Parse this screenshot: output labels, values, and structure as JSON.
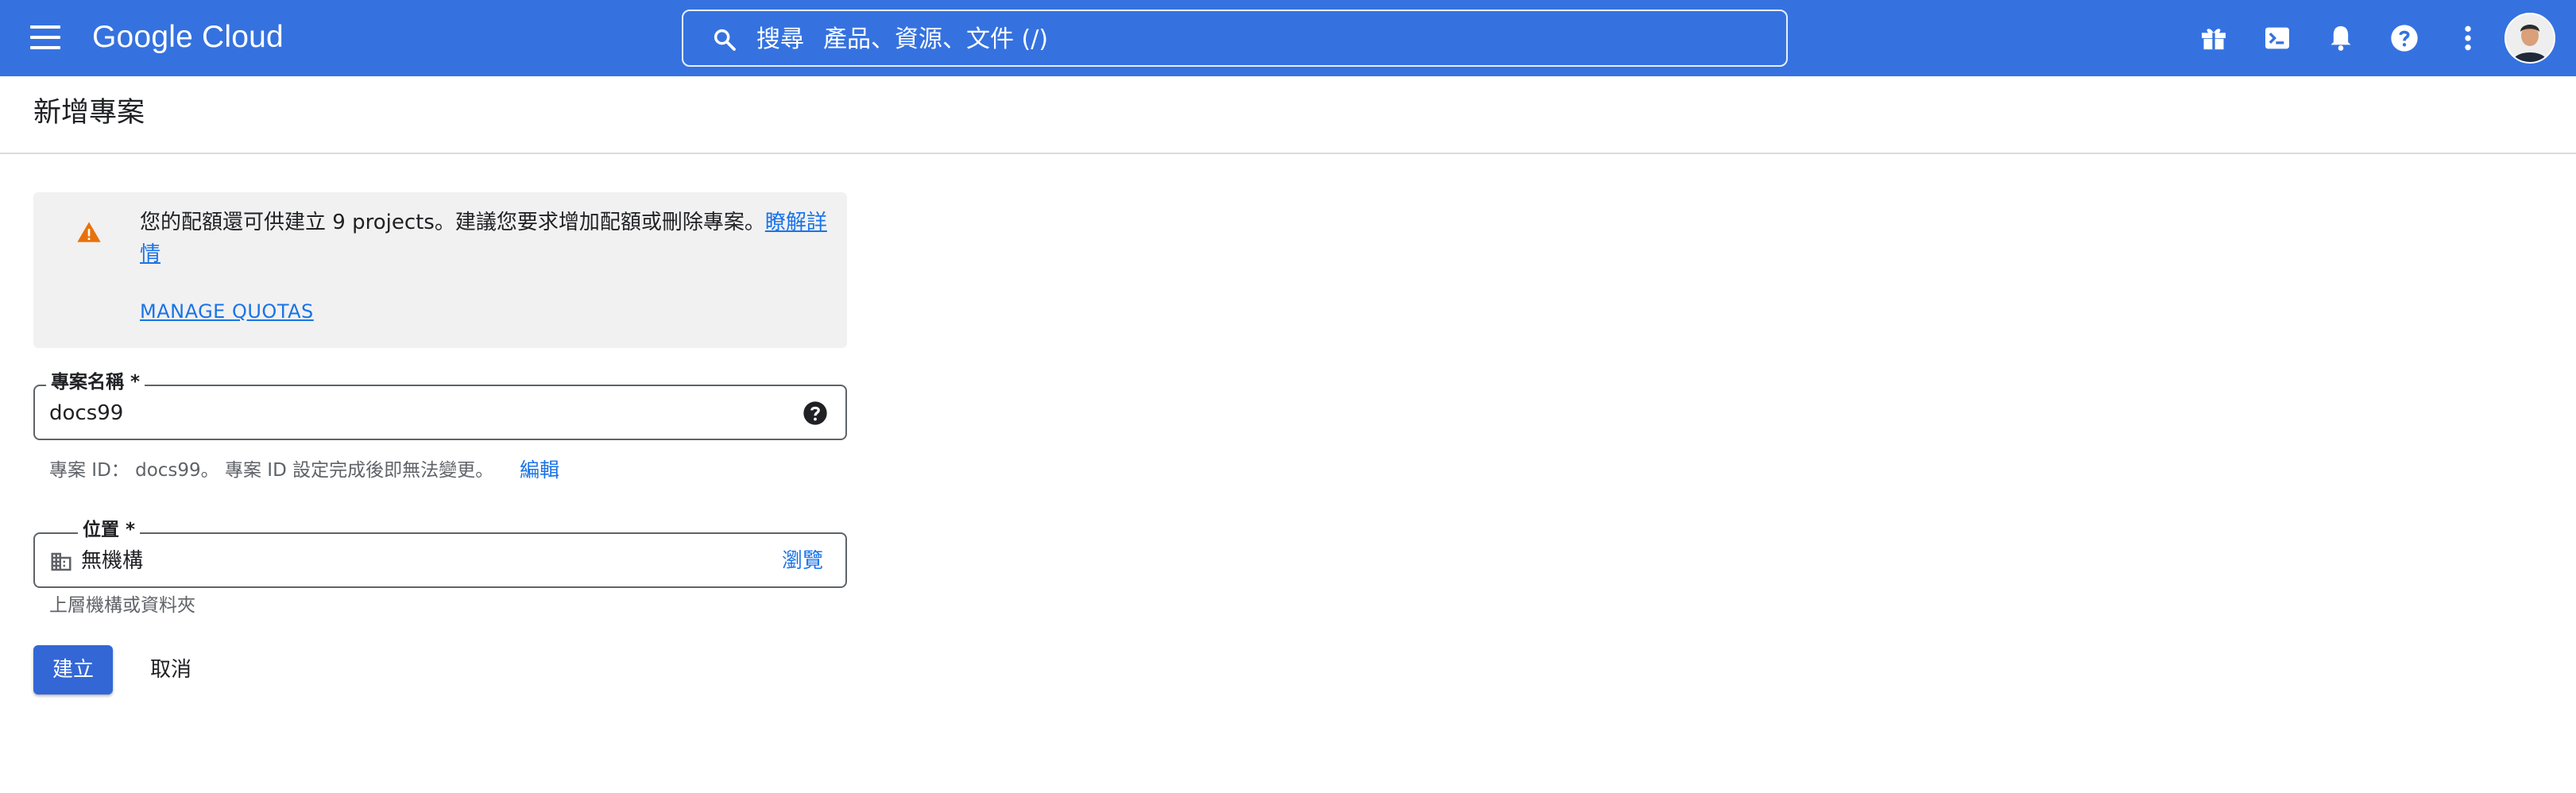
{
  "header": {
    "logo_text": "Google Cloud",
    "search": {
      "key_label": "搜尋",
      "placeholder": "產品、資源、文件 (/)"
    },
    "icons": [
      "menu-icon",
      "search-icon",
      "gift-icon",
      "terminal-icon",
      "bell-icon",
      "help-icon",
      "more-vert-icon",
      "avatar"
    ],
    "bar_color": "#3572e0"
  },
  "page": {
    "title": "新增專案"
  },
  "notice": {
    "text": "您的配額還可供建立 9 projects。建議您要求增加配額或刪除專案。",
    "learn_more": "瞭解詳情",
    "manage_quotas": "MANAGE QUOTAS",
    "icon": "warning-icon",
    "icon_color": "#e8710a"
  },
  "project_name": {
    "label": "專案名稱 *",
    "value": "docs99",
    "hint": "專案 ID： docs99。 專案 ID 設定完成後即無法變更。",
    "edit": "編輯"
  },
  "location": {
    "label": "位置 *",
    "value": "無機構",
    "browse": "瀏覽",
    "hint": "上層機構或資料夾"
  },
  "actions": {
    "create": "建立",
    "cancel": "取消",
    "primary_color": "#3367d6"
  }
}
